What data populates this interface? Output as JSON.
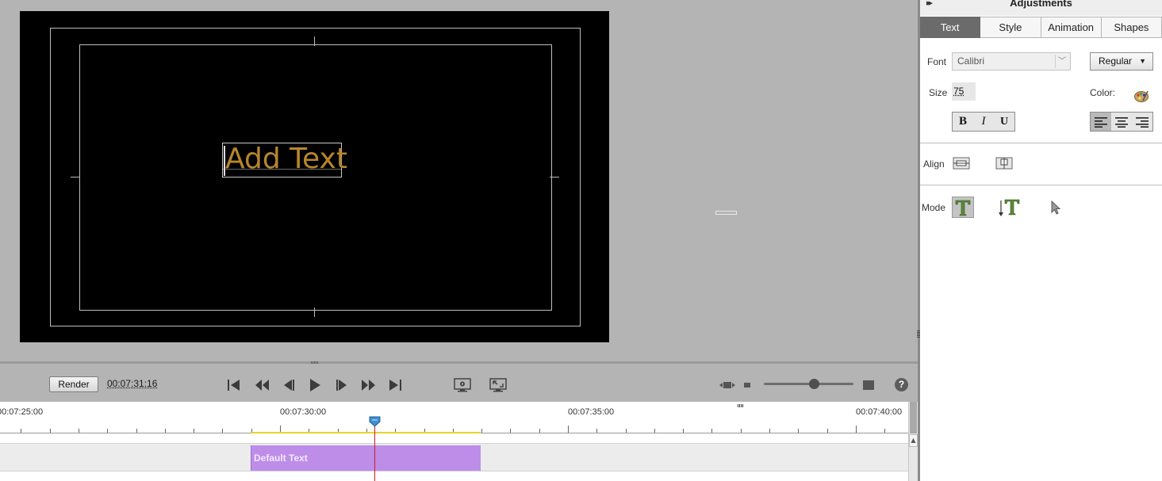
{
  "monitor": {
    "text_value": "Add Text"
  },
  "transport": {
    "render_label": "Render",
    "timecode": "00:07:31:16",
    "help_label": "?",
    "zoom_level": 0.56
  },
  "timeline": {
    "ruler_labels": [
      "00:07:25:00",
      "00:07:30:00",
      "00:07:35:00",
      "00:07:40:00"
    ],
    "clip_label": "Default Text",
    "scroll_up": "▲"
  },
  "panel": {
    "collapse_icon": "▸▸",
    "title": "Adjustments",
    "tabs": [
      {
        "label": "Text",
        "active": true
      },
      {
        "label": "Style",
        "active": false
      },
      {
        "label": "Animation",
        "active": false
      },
      {
        "label": "Shapes",
        "active": false
      }
    ],
    "font_label": "Font",
    "font_value": "Calibri",
    "font_chevron": "﹀",
    "style_value": "Regular",
    "style_chevron": "▼",
    "size_label": "Size",
    "size_value": "75",
    "color_label": "Color:",
    "bold_label": "B",
    "italic_label": "I",
    "underline_label": "U",
    "align_label": "Align",
    "mode_label": "Mode"
  },
  "colors": {
    "text_fill": "#b7862c",
    "clip": "#bd8de8",
    "work_area": "#e8d32a",
    "playhead": "#cc1f1f",
    "tab_active": "#6b6b6b"
  }
}
